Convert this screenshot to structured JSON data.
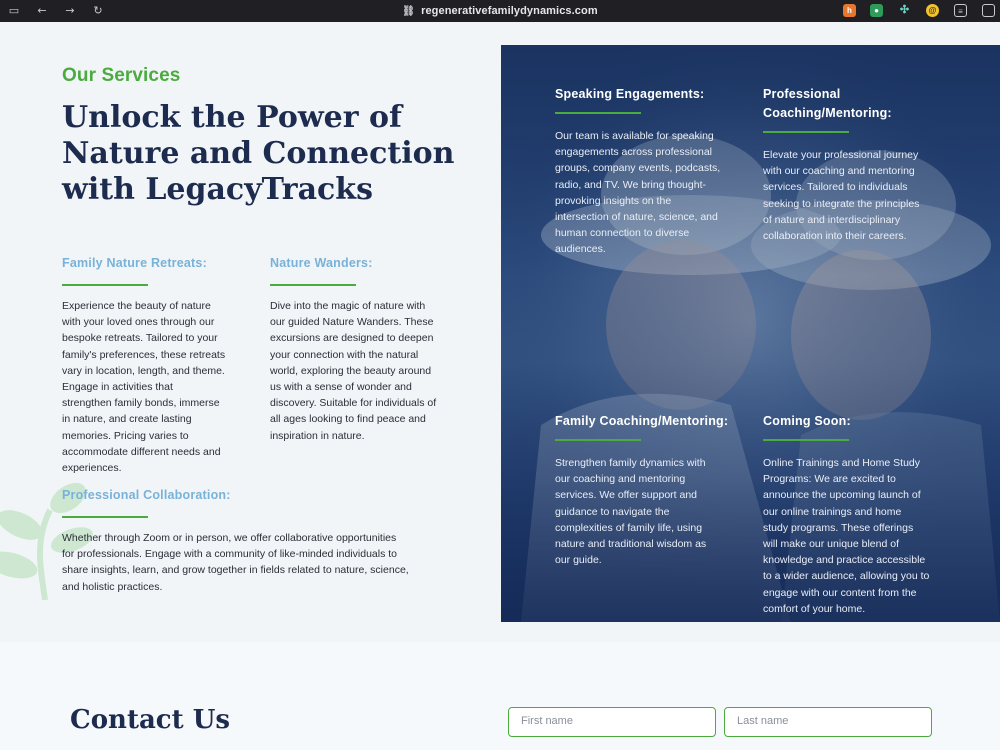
{
  "browser": {
    "url": "regenerativefamilydynamics.com"
  },
  "colors": {
    "accent_green": "#4bab3e",
    "heading_navy": "#1d2b4f",
    "service_title_blue": "#79b2d8"
  },
  "icons": [
    "sidebar-icon",
    "back-arrow-icon",
    "forward-arrow-icon",
    "reload-icon",
    "link-icon"
  ],
  "services": {
    "kicker": "Our Services",
    "headline": "Unlock the Power of Nature and Connection with LegacyTracks",
    "left_items": [
      {
        "title": "Family Nature Retreats:",
        "lines": [
          "Experience the beauty of nature",
          "with your loved ones through our",
          "bespoke retreats. Tailored to your",
          "family's preferences, these retreats",
          "vary in location, length, and theme.",
          "Engage in activities that",
          "strengthen family bonds, immerse",
          "in nature, and create lasting",
          "memories. Pricing varies to",
          "accommodate different needs and",
          "experiences."
        ]
      },
      {
        "title": "Nature Wanders:",
        "lines": [
          "Dive into the magic of nature with",
          "our guided Nature Wanders. These",
          "excursions are designed to deepen",
          "your connection with the natural",
          "world, exploring the beauty around",
          "us with a sense of wonder and",
          "discovery. Suitable for individuals of",
          "all ages looking to find peace and",
          "inspiration in nature."
        ]
      },
      {
        "title": "Professional Collaboration:",
        "lines": [
          "Whether through Zoom or in person, we offer collaborative opportunities",
          "for professionals. Engage with a community of like-minded individuals to",
          "share insights, learn, and grow together in fields related to nature, science,",
          "and holistic practices."
        ]
      }
    ],
    "right_items": [
      {
        "title": "Speaking Engagements:",
        "lines": [
          "Our team is available for speaking",
          "engagements across professional",
          "groups, company events, podcasts,",
          "radio, and TV. We bring thought-",
          "provoking insights on the",
          "intersection of nature, science, and",
          "human connection to diverse",
          "audiences."
        ]
      },
      {
        "title": "Professional Coaching/Mentoring:",
        "lines": [
          "Elevate your professional journey",
          "with our coaching and mentoring",
          "services. Tailored to individuals",
          "seeking to integrate the principles",
          "of nature and interdisciplinary",
          "collaboration into their careers."
        ]
      },
      {
        "title": "Family Coaching/Mentoring:",
        "lines": [
          "Strengthen family dynamics with",
          "our coaching and mentoring",
          "services. We offer support and",
          "guidance to navigate the",
          "complexities of family life, using",
          "nature and traditional wisdom as",
          "our guide."
        ]
      },
      {
        "title": "Coming Soon:",
        "lines": [
          "Online Trainings and Home Study",
          "Programs: We are excited to",
          "announce the upcoming launch of",
          "our online trainings and home",
          "study programs. These offerings",
          "will make our unique blend of",
          "knowledge and practice accessible",
          "to a wider audience, allowing you to",
          "engage with our content from the",
          "comfort of your home."
        ]
      }
    ]
  },
  "contact": {
    "title": "Contact Us",
    "first_name_placeholder": "First name",
    "last_name_placeholder": "Last name"
  }
}
